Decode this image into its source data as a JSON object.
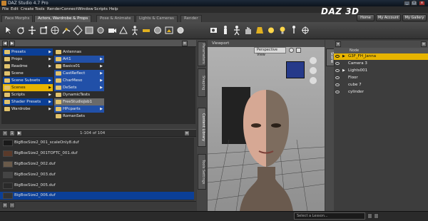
{
  "window": {
    "title": "DAZ Studio 4.7 Pro",
    "min": "_",
    "max": "□",
    "close": "x"
  },
  "menu": [
    "File",
    "Edit",
    "Create",
    "Tools",
    "Render",
    "Connect",
    "Window",
    "Scripts",
    "Help"
  ],
  "brand": {
    "logo": "DAZ 3D",
    "buttons": [
      "Home",
      "My Account",
      "My Gallery"
    ]
  },
  "tabs": [
    "Face Morphs",
    "Actors, Wardrobe & Props",
    "Pose & Animate",
    "Lights & Cameras",
    "Render"
  ],
  "toolbar_icons": [
    "select-icon",
    "rotate-icon",
    "translate-icon",
    "scale-icon",
    "universal-icon",
    "joint-icon",
    "node-icon",
    "surface-icon",
    "region-icon",
    "camera-icon",
    "geometry-icon",
    "pose-icon",
    "ruler-icon",
    "morph-icon",
    "render-icon",
    "camera-tool-icon",
    "figure-icon",
    "person-icon",
    "hand-icon",
    "shader-icon",
    "light-icon",
    "crosshair-icon"
  ],
  "left": {
    "categories": [
      "Presets",
      "Props",
      "Readme",
      "Scene",
      "Scene Subsets",
      "Scenes",
      "Scripts",
      "Shader Presets",
      "Wardrobe"
    ],
    "selected_category": "Scenes",
    "subcategories": [
      "Antennas",
      "Art1",
      "Basics01",
      "CastReflect",
      "CharMeso",
      "DeSets",
      "DynamicTests",
      "FreeStudioJob1",
      "HPcparts",
      "RomanSets"
    ],
    "pager": "1-104 of 104",
    "files": [
      "BigBoxSize2_001_scaleOnly8.duf",
      "BigBoxSize2_001TOFTC_001.duf",
      "BigBoxSize2_002.duf",
      "BigBoxSize2_003.duf",
      "BigBoxSize2_005.duf",
      "BigBoxSize2_006.duf"
    ],
    "selected_file": "BigBoxSize2_006.duf"
  },
  "viewport": {
    "label": "Viewport",
    "view": "Perspective View"
  },
  "side_tabs": [
    "Content Library",
    "Shaping",
    "Tools Settings",
    "Parameters"
  ],
  "scene": {
    "header": "Node",
    "items": [
      {
        "name": "G3F_FH_Janna",
        "highlight": true
      },
      {
        "name": "Camera 3",
        "highlight": false
      },
      {
        "name": "Lights001",
        "highlight": false
      },
      {
        "name": "Floor",
        "highlight": false
      },
      {
        "name": "cube 7",
        "highlight": false
      },
      {
        "name": "cylinder",
        "highlight": false
      }
    ],
    "tab": "Scene"
  },
  "status": {
    "lesson_placeholder": "Select a Lesson..."
  }
}
